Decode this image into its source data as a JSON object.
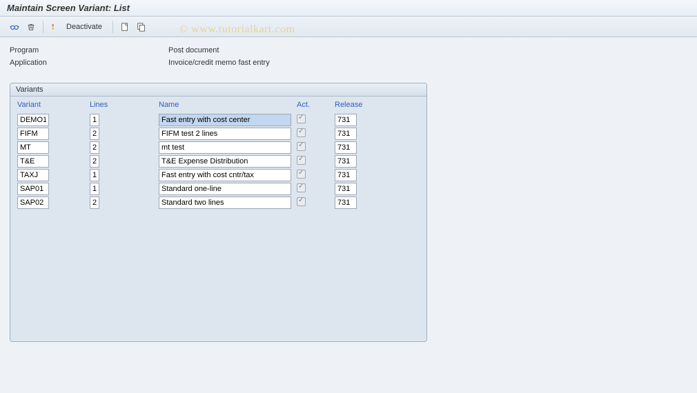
{
  "header": {
    "title": "Maintain Screen Variant: List"
  },
  "toolbar": {
    "deactivate_label": "Deactivate"
  },
  "info": {
    "program_label": "Program",
    "program_value": "Post document",
    "application_label": "Application",
    "application_value": "Invoice/credit memo fast entry"
  },
  "variants_panel": {
    "title": "Variants",
    "columns": {
      "variant": "Variant",
      "lines": "Lines",
      "name": "Name",
      "act": "Act.",
      "release": "Release"
    },
    "rows": [
      {
        "variant": "DEMO1",
        "lines": "1",
        "name": "Fast entry with cost center",
        "act": true,
        "release": "731",
        "selected": true
      },
      {
        "variant": "FIFM",
        "lines": "2",
        "name": "FIFM test 2 lines",
        "act": true,
        "release": "731",
        "selected": false
      },
      {
        "variant": "MT",
        "lines": "2",
        "name": "mt test",
        "act": true,
        "release": "731",
        "selected": false
      },
      {
        "variant": "T&E",
        "lines": "2",
        "name": "T&E Expense Distribution",
        "act": true,
        "release": "731",
        "selected": false
      },
      {
        "variant": "TAXJ",
        "lines": "1",
        "name": "Fast entry with cost cntr/tax",
        "act": true,
        "release": "731",
        "selected": false
      },
      {
        "variant": "SAP01",
        "lines": "1",
        "name": "Standard one-line",
        "act": true,
        "release": "731",
        "selected": false
      },
      {
        "variant": "SAP02",
        "lines": "2",
        "name": "Standard two lines",
        "act": true,
        "release": "731",
        "selected": false
      }
    ]
  },
  "watermark": "© www.tutorialkart.com"
}
